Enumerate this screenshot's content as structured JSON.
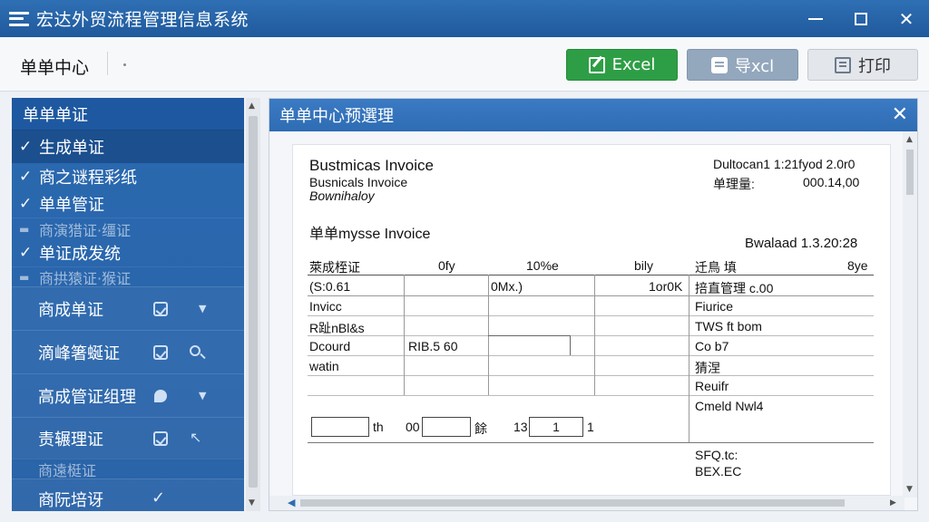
{
  "window": {
    "title": "宏达外贸流程管理信息系统"
  },
  "toolbar": {
    "breadcrumb": "单单中心",
    "excel_label": "Excel",
    "export_label": "导xcl",
    "print_label": "打印"
  },
  "sidebar": {
    "header": "单单单证",
    "items": [
      {
        "label": "生成单证",
        "checked": true,
        "selected": true
      },
      {
        "label": "商之谜程彩纸",
        "checked": true
      },
      {
        "label": "单单管证",
        "checked": true
      },
      {
        "label": "商演猎证·缰证",
        "checked": false
      },
      {
        "label": "单证成发统",
        "checked": true
      },
      {
        "label": "商拱猿证·猴证",
        "checked": false
      },
      {
        "label": "商成单证",
        "icons": [
          "checkbox-icon",
          "caret-down-icon"
        ]
      },
      {
        "label": "滴峰箸蜒证",
        "icons": [
          "checkbox-icon",
          "search-icon"
        ]
      },
      {
        "label": "高成管证组理",
        "icons": [
          "bubble-icon",
          "caret-down-icon"
        ]
      },
      {
        "label": "责辗理证",
        "icons": [
          "checkbox-icon",
          "cursor-icon"
        ]
      },
      {
        "label": "商遠梃证"
      },
      {
        "label": "商阮培讶",
        "icons": [
          "check-icon"
        ]
      }
    ]
  },
  "panel": {
    "title": "单单中心预選理"
  },
  "document": {
    "title1": "Bustmicas Invoice",
    "title2": "Busnicals Invoice",
    "title3": "Bownihaloy",
    "meta_top": "Dultocan1 1:21fyod 2.0r0",
    "meta_qty_label": "单理量:",
    "meta_qty_value": "000.14,00",
    "subtitle": "单单mysse Invoice",
    "ref": "Bwalaad 1.3.20:28",
    "headers": [
      "萊成桎证",
      "0fy",
      "10%e",
      "bily",
      "迁鳥 填",
      "8ye"
    ],
    "row1": [
      "(S:0.61",
      "0Mx.)",
      "1or0K",
      "掊直管理 c.00"
    ],
    "left_rows": [
      "Invicc",
      "R趾nBl&s",
      "Dcourd",
      "watin"
    ],
    "dcourd_value": "RIB.5 60",
    "right_rows": [
      "Fiurice",
      "TWS ft bom",
      "Co b7",
      "猜涅",
      "Reuifr",
      "Cmeld Nwl4"
    ],
    "bottom_labels": [
      "th",
      "00",
      "餘",
      "13",
      "1",
      "1"
    ],
    "footer": [
      "SFQ.tc:",
      "BEX.EC"
    ]
  }
}
